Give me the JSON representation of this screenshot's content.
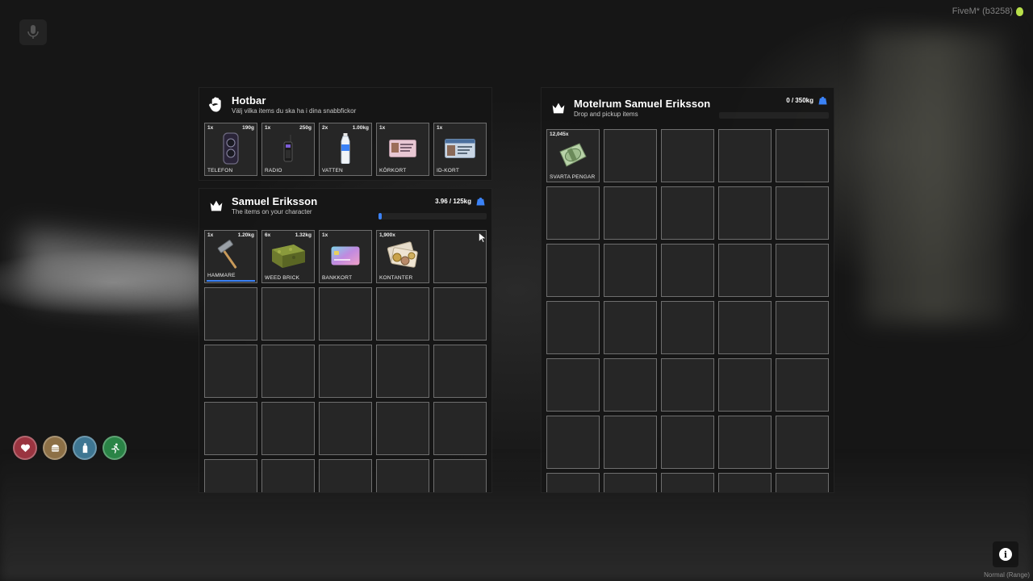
{
  "top_right": {
    "brand": "FiveM* (b3258)"
  },
  "bottom_right": {
    "mode": "Normal (Range)"
  },
  "hotbar": {
    "title": "Hotbar",
    "subtitle": "Välj vilka items du ska ha i dina snabbfickor",
    "slots": [
      {
        "qty": "1x",
        "weight": "190g",
        "label": "TELEFON",
        "item": "phone"
      },
      {
        "qty": "1x",
        "weight": "250g",
        "label": "RADIO",
        "item": "radio"
      },
      {
        "qty": "2x",
        "weight": "1.00kg",
        "label": "VATTEN",
        "item": "water"
      },
      {
        "qty": "1x",
        "weight": "",
        "label": "KÖRKORT",
        "item": "license"
      },
      {
        "qty": "1x",
        "weight": "",
        "label": "ID-KORT",
        "item": "idcard"
      }
    ]
  },
  "player_inventory": {
    "title": "Samuel Eriksson",
    "subtitle": "The items on your character",
    "weight": "3.96 / 125kg",
    "weight_fraction": 0.032,
    "slots": [
      {
        "qty": "1x",
        "weight": "1.20kg",
        "label": "HAMMARE",
        "item": "hammer",
        "durability": 1.0
      },
      {
        "qty": "6x",
        "weight": "1.32kg",
        "label": "WEED BRICK",
        "item": "weed"
      },
      {
        "qty": "1x",
        "weight": "",
        "label": "BANKKORT",
        "item": "bankcard"
      },
      {
        "qty": "1,900x",
        "weight": "",
        "label": "KONTANTER",
        "item": "cash"
      }
    ],
    "total_slots": 25
  },
  "motel_inventory": {
    "title": "Motelrum Samuel Eriksson",
    "subtitle": "Drop and pickup items",
    "weight": "0 / 350kg",
    "weight_fraction": 0,
    "slots": [
      {
        "qty": "12,045x",
        "weight": "",
        "label": "SVARTA PENGAR",
        "item": "blackmoney"
      }
    ],
    "total_slots": 35
  },
  "status_icons": [
    {
      "name": "health-icon",
      "color": "#b03a45"
    },
    {
      "name": "hunger-icon",
      "color": "#a8834a"
    },
    {
      "name": "thirst-icon",
      "color": "#4a8aa8"
    },
    {
      "name": "stamina-icon",
      "color": "#2f9a4e"
    }
  ]
}
